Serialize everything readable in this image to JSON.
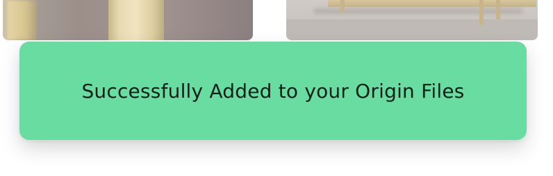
{
  "toast": {
    "message": "Successfully Added to your Origin Files",
    "background_color": "#69dca2"
  },
  "thumbnails": [
    {
      "name": "image-thumbnail-left"
    },
    {
      "name": "image-thumbnail-right"
    }
  ]
}
